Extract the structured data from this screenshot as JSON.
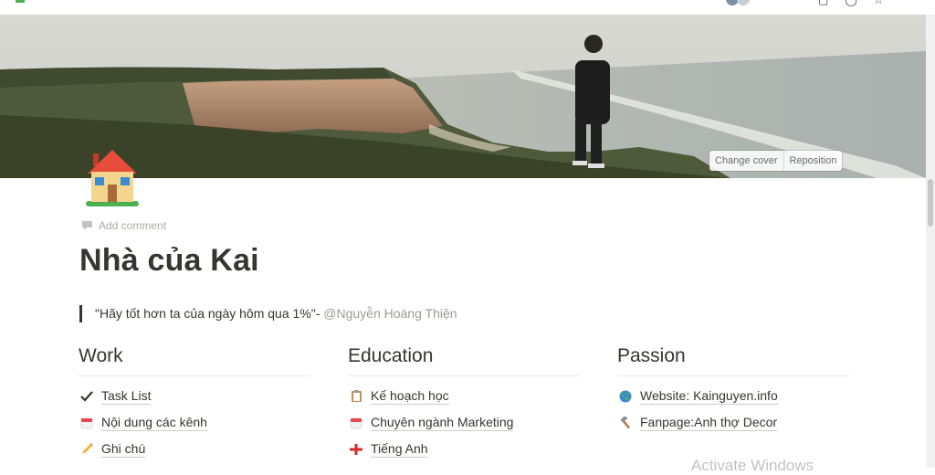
{
  "cover": {
    "change_cover_label": "Change cover",
    "reposition_label": "Reposition"
  },
  "page": {
    "icon": "house-icon",
    "add_comment_label": "Add comment",
    "title": "Nhà của Kai",
    "quote": {
      "text": "\"Hãy tốt hơn ta của ngày hôm qua 1%\"- ",
      "mention": "@Nguyễn Hoàng Thiện"
    }
  },
  "columns": [
    {
      "heading": "Work",
      "items": [
        {
          "icon": "checkmark-icon",
          "label": "Task List"
        },
        {
          "icon": "calendar-icon",
          "label": "Nội dung các kênh"
        },
        {
          "icon": "pencil-icon",
          "label": "Ghi chú"
        }
      ]
    },
    {
      "heading": "Education",
      "items": [
        {
          "icon": "clipboard-icon",
          "label": "Kế hoạch học"
        },
        {
          "icon": "calendar-icon",
          "label": "Chuyên ngành Marketing"
        },
        {
          "icon": "england-flag-icon",
          "label": "Tiếng Anh"
        }
      ]
    },
    {
      "heading": "Passion",
      "items": [
        {
          "icon": "globe-icon",
          "label": "Website: Kainguyen.info"
        },
        {
          "icon": "hammer-icon",
          "label": "Fanpage:Anh thợ Decor"
        }
      ]
    }
  ],
  "watermark": "Activate Windows",
  "colors": {
    "text": "#37352f",
    "muted": "#9b9a97",
    "divider": "#e9e9e7"
  }
}
